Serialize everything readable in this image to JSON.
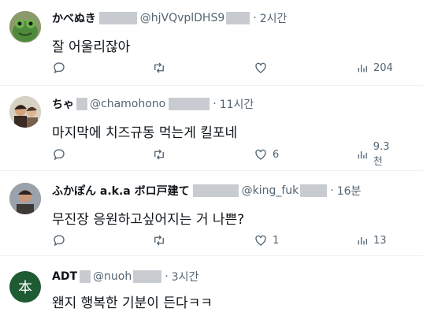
{
  "tweets": [
    {
      "name": "かべぬき",
      "handle": "@hjVQvplDHS9",
      "dot": "·",
      "time": "2시간",
      "text": "잘 어울리잖아",
      "likes": "",
      "views": "204",
      "avatar": "green-creature"
    },
    {
      "name": "ちゃ",
      "handle": "@chamohono",
      "dot": "·",
      "time": "11시간",
      "text": "마지막에 치즈규동 먹는게 킬포네",
      "likes": "6",
      "views": "9.3천",
      "avatar": "photo-people"
    },
    {
      "name": "ふかぽん a.k.a ボロ戸建て",
      "handle": "@king_fuk",
      "dot": "·",
      "time": "16분",
      "text": "무진장 응원하고싶어지는 거 나쁜?",
      "likes": "1",
      "views": "13",
      "avatar": "photo-person"
    },
    {
      "name": "ADT",
      "handle": "@nuoh",
      "dot": "·",
      "time": "3시간",
      "text": "왠지 행복한 기분이 든다ㅋㅋ",
      "avatar_letter": "本",
      "avatar": "letter"
    }
  ],
  "colors": {
    "icon": "#536471",
    "avatar_green": "#1e5a32",
    "divider": "#eff3f4"
  }
}
